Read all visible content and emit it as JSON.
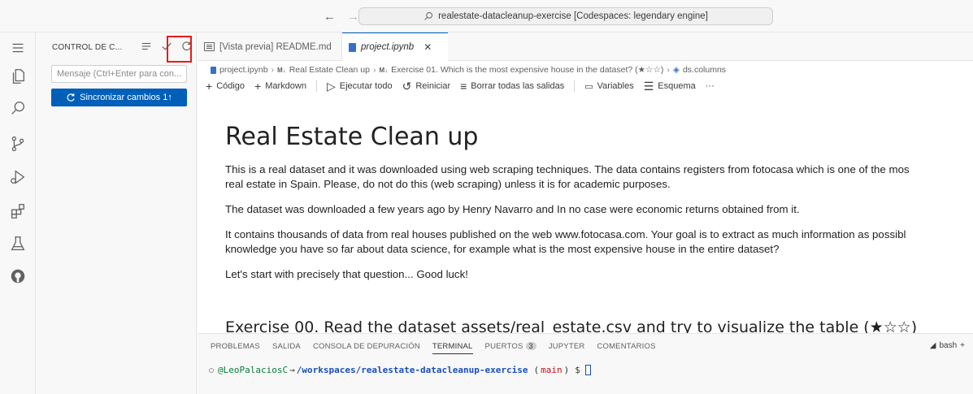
{
  "titlebar": {
    "back_arrow": "←",
    "forward_arrow": "→",
    "command_center": "realestate-datacleanup-exercise [Codespaces: legendary engine]"
  },
  "activity_bar": {
    "icons": [
      "menu-icon",
      "explorer-icon",
      "search-icon",
      "source-control-icon",
      "run-debug-icon",
      "extensions-icon",
      "testing-icon",
      "github-icon"
    ]
  },
  "sidebar": {
    "title": "CONTROL DE C...",
    "commit_placeholder": "Mensaje (Ctrl+Enter para con...",
    "sync_button": "Sincronizar cambios 1↑",
    "more_actions": "···"
  },
  "tabs": [
    {
      "label": "[Vista previa] README.md"
    },
    {
      "label": "project.ipynb"
    }
  ],
  "breadcrumb": {
    "file": "project.ipynb",
    "section1": "Real Estate Clean up",
    "section2": "Exercise 01. Which is the most expensive house in the dataset? (★☆☆)",
    "symbol": "ds.columns",
    "md_marker": "M↓"
  },
  "notebook_toolbar": {
    "code": "Código",
    "markdown": "Markdown",
    "run_all": "Ejecutar todo",
    "restart": "Reiniciar",
    "clear_outputs": "Borrar todas las salidas",
    "variables": "Variables",
    "outline": "Esquema",
    "more": "···"
  },
  "markdown_cell": {
    "heading": "Real Estate Clean up",
    "p1_line1": "This is a real dataset and it was downloaded using web scraping techniques. The data contains registers from fotocasa which is one of the mos",
    "p1_line2": "real estate in Spain. Please, do not do this (web scraping) unless it is for academic purposes.",
    "p2": "The dataset was downloaded a few years ago by Henry Navarro and In no case were economic returns obtained from it.",
    "p3_line1": "It contains thousands of data from real houses published on the web www.fotocasa.com. Your goal is to extract as much information as possibl",
    "p3_line2": "knowledge you have so far about data science, for example what is the most expensive house in the entire dataset?",
    "p4": "Let's start with precisely that question... Good luck!",
    "heading2": "Exercise 00. Read the dataset assets/real_estate.csv and try to visualize the table (★☆☆)"
  },
  "panel": {
    "tabs": [
      "PROBLEMAS",
      "SALIDA",
      "CONSOLA DE DEPURACIÓN",
      "TERMINAL",
      "PUERTOS",
      "JUPYTER",
      "COMENTARIOS"
    ],
    "ports_count": "3",
    "shell": "bash",
    "add": "+",
    "terminal": {
      "user": "@LeoPalaciosC",
      "arrow": "→",
      "path": "/workspaces/realestate-datacleanup-exercise",
      "branch_open": "(",
      "branch": "main",
      "branch_close": ")",
      "prompt": "$"
    }
  }
}
